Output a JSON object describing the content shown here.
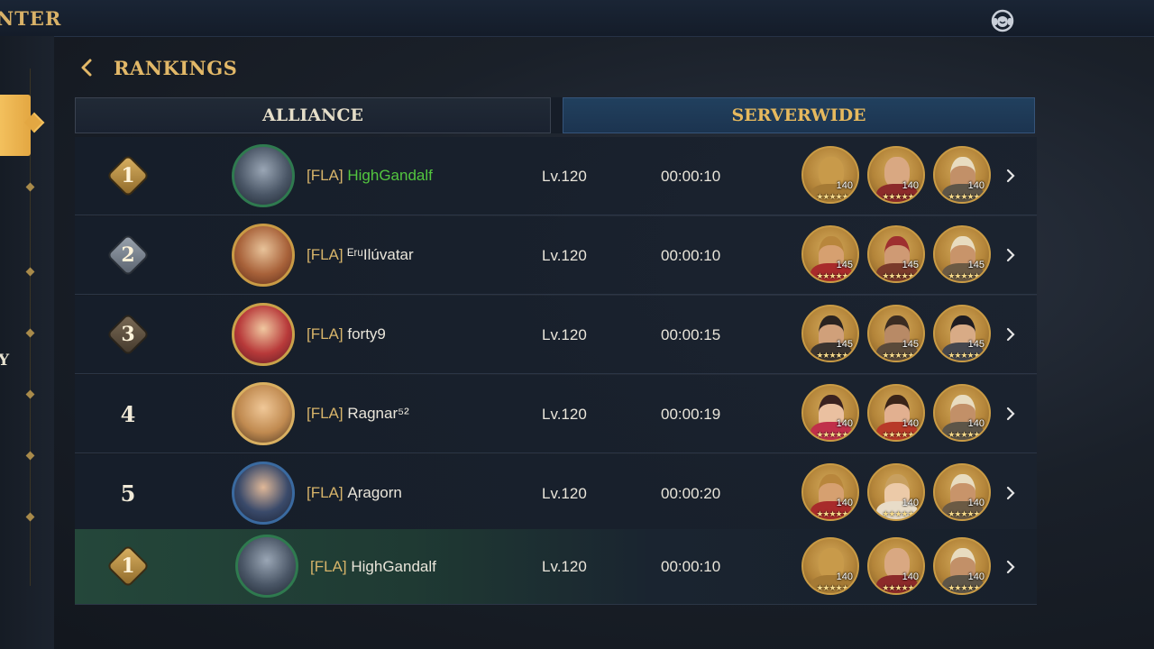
{
  "topbar": {
    "title": "NTER"
  },
  "sidebar": {
    "partial_label": "Y"
  },
  "header": {
    "title": "RANKINGS"
  },
  "tabs": [
    {
      "label": "ALLIANCE",
      "active": false
    },
    {
      "label": "SERVERWIDE",
      "active": true
    }
  ],
  "rows": [
    {
      "rank": "1",
      "tag": "[FLA]",
      "name": "HighGandalf",
      "level": "Lv.120",
      "time": "00:00:10",
      "heroes": [
        {
          "level": "140"
        },
        {
          "level": "140"
        },
        {
          "level": "140"
        }
      ]
    },
    {
      "rank": "2",
      "tag": "[FLA]",
      "name": "ᴱʳᵘIlúvatar",
      "level": "Lv.120",
      "time": "00:00:10",
      "heroes": [
        {
          "level": "145"
        },
        {
          "level": "145"
        },
        {
          "level": "145"
        }
      ]
    },
    {
      "rank": "3",
      "tag": "[FLA]",
      "name": "forty9",
      "level": "Lv.120",
      "time": "00:00:15",
      "heroes": [
        {
          "level": "145"
        },
        {
          "level": "145"
        },
        {
          "level": "145"
        }
      ]
    },
    {
      "rank": "4",
      "tag": "[FLA]",
      "name": "Ragnar⁵²",
      "level": "Lv.120",
      "time": "00:00:19",
      "heroes": [
        {
          "level": "140"
        },
        {
          "level": "140"
        },
        {
          "level": "140"
        }
      ]
    },
    {
      "rank": "5",
      "tag": "[FLA]",
      "name": "Ąragorn",
      "level": "Lv.120",
      "time": "00:00:20",
      "heroes": [
        {
          "level": "140"
        },
        {
          "level": "140"
        },
        {
          "level": "140"
        }
      ]
    }
  ],
  "my_row": {
    "rank": "1",
    "tag": "[FLA]",
    "name": "HighGandalf",
    "level": "Lv.120",
    "time": "00:00:10",
    "heroes": [
      {
        "level": "140"
      },
      {
        "level": "140"
      },
      {
        "level": "140"
      }
    ]
  },
  "stars": "★★★★★",
  "colors": {
    "gold": "#e2b868",
    "highlight_name": "#53c63f",
    "my_row": "#24473a"
  }
}
